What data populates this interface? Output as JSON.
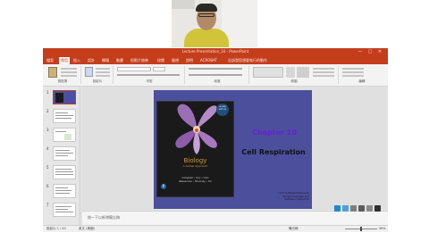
{
  "window": {
    "title": "Lecture Presentation_10 - PowerPoint",
    "controls": [
      "—",
      "□",
      "✕"
    ]
  },
  "tabs": {
    "file": "檔案",
    "items": [
      "常用",
      "插入",
      "設計",
      "轉場",
      "動畫",
      "投影片放映",
      "校閱",
      "檢視",
      "說明",
      "ACROBAT"
    ],
    "tell_me": "告訴我您想要執行的動作"
  },
  "ribbon": {
    "groups": [
      "剪貼簿",
      "投影片",
      "字型",
      "段落",
      "繪圖",
      "編輯"
    ]
  },
  "thumbnails": [
    "1",
    "2",
    "3",
    "4",
    "5",
    "6",
    "7"
  ],
  "slide": {
    "book": {
      "title": "Biology",
      "subtitle": "A Global Approach",
      "edition": "ELEVENTH EDITION",
      "authors": "Campbell • Urry • Cain\nWasserman • Minorsky • Orr",
      "badge": "GLOBAL EDITION",
      "publisher": "P"
    },
    "chapter": "Chapter 10",
    "topic": "Cell Respiration",
    "credit": "Lecture Presentations by\nNicole Tunbridge and\nKathleen Fitzpatrick"
  },
  "notes": {
    "placeholder": "按一下以新增備忘稿"
  },
  "status": {
    "slide_info": "投影片 1 / 45",
    "language": "英文 (美國)",
    "notes_btn": "備忘稿",
    "zoom": "46%"
  },
  "colors": {
    "accent": "#c43e1c",
    "slide_bg": "#4c4f9c",
    "chapter_text": "#6a1ed6"
  }
}
